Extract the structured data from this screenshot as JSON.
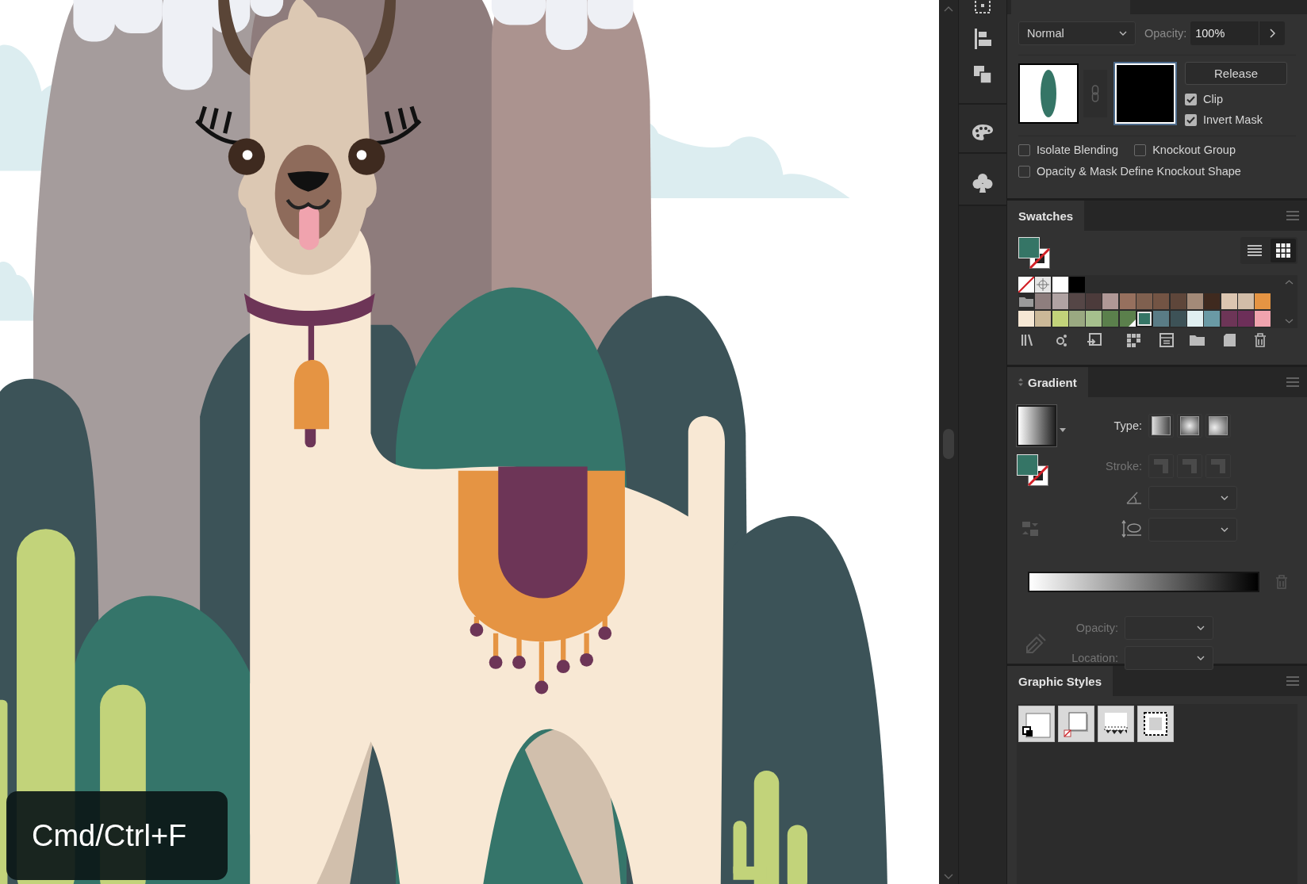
{
  "canvas": {
    "shortcut_hint": "Cmd/Ctrl+F"
  },
  "transparency": {
    "blend_mode": "Normal",
    "opacity_label": "Opacity:",
    "opacity_value": "100%",
    "release_button": "Release",
    "mask_options": [
      {
        "label": "Clip",
        "checked": true
      },
      {
        "label": "Invert Mask",
        "checked": true
      }
    ],
    "group_options": [
      {
        "label": "Isolate Blending",
        "checked": false
      },
      {
        "label": "Knockout Group",
        "checked": false
      },
      {
        "label": "Opacity & Mask Define Knockout Shape",
        "checked": false
      }
    ]
  },
  "swatches": {
    "title": "Swatches",
    "view_modes": [
      {
        "kind": "list",
        "selected": false
      },
      {
        "kind": "grid",
        "selected": true
      }
    ],
    "rows": [
      {
        "folder": false,
        "items": [
          {
            "kind": "none",
            "selected": false
          },
          {
            "kind": "registration",
            "selected": false
          },
          {
            "kind": "color",
            "color": "#ffffff",
            "selected": false
          },
          {
            "kind": "color",
            "color": "#000000",
            "selected": false
          }
        ]
      },
      {
        "folder": true,
        "items": [
          {
            "kind": "color",
            "color": "#8e7e7e",
            "selected": false
          },
          {
            "kind": "color",
            "color": "#b0a3a3",
            "selected": false
          },
          {
            "kind": "color",
            "color": "#554646",
            "selected": false
          },
          {
            "kind": "color",
            "color": "#4c3b3b",
            "selected": false
          },
          {
            "kind": "color",
            "color": "#b09896",
            "selected": false
          },
          {
            "kind": "color",
            "color": "#96705e",
            "selected": false
          },
          {
            "kind": "color",
            "color": "#7f604f",
            "selected": false
          },
          {
            "kind": "color",
            "color": "#735444",
            "selected": false
          },
          {
            "kind": "color",
            "color": "#5e463a",
            "selected": false
          },
          {
            "kind": "color",
            "color": "#a38a78",
            "selected": false
          },
          {
            "kind": "color",
            "color": "#3f2a1f",
            "selected": false
          },
          {
            "kind": "color",
            "color": "#dcc6b1",
            "selected": false
          },
          {
            "kind": "color",
            "color": "#d2bda8",
            "selected": false
          },
          {
            "kind": "color",
            "color": "#e59443",
            "selected": false
          }
        ]
      },
      {
        "folder": false,
        "items": [
          {
            "kind": "color",
            "color": "#f6e7d4",
            "selected": false
          },
          {
            "kind": "color",
            "color": "#cbb898",
            "selected": false
          },
          {
            "kind": "color",
            "color": "#c2d37a",
            "selected": false
          },
          {
            "kind": "color",
            "color": "#9aa981",
            "selected": false
          },
          {
            "kind": "color",
            "color": "#a6c08d",
            "selected": false
          },
          {
            "kind": "color",
            "color": "#5b804c",
            "selected": false
          },
          {
            "kind": "global",
            "color": "#5b804c",
            "selected": false
          },
          {
            "kind": "color",
            "color": "#357566",
            "selected": true
          },
          {
            "kind": "color",
            "color": "#5a7c86",
            "selected": false
          },
          {
            "kind": "color",
            "color": "#3d5257",
            "selected": false
          },
          {
            "kind": "color",
            "color": "#e0eff1",
            "selected": false
          },
          {
            "kind": "color",
            "color": "#6a9aa5",
            "selected": false
          },
          {
            "kind": "color",
            "color": "#6d3557",
            "selected": false
          },
          {
            "kind": "color",
            "color": "#6d2f59",
            "selected": false
          },
          {
            "kind": "color",
            "color": "#f0a3ae",
            "selected": false
          }
        ]
      }
    ]
  },
  "gradient": {
    "title": "Gradient",
    "type_label": "Type:",
    "stroke_label": "Stroke:",
    "opacity_label": "Opacity:",
    "location_label": "Location:"
  },
  "graphic_styles": {
    "title": "Graphic Styles"
  }
}
